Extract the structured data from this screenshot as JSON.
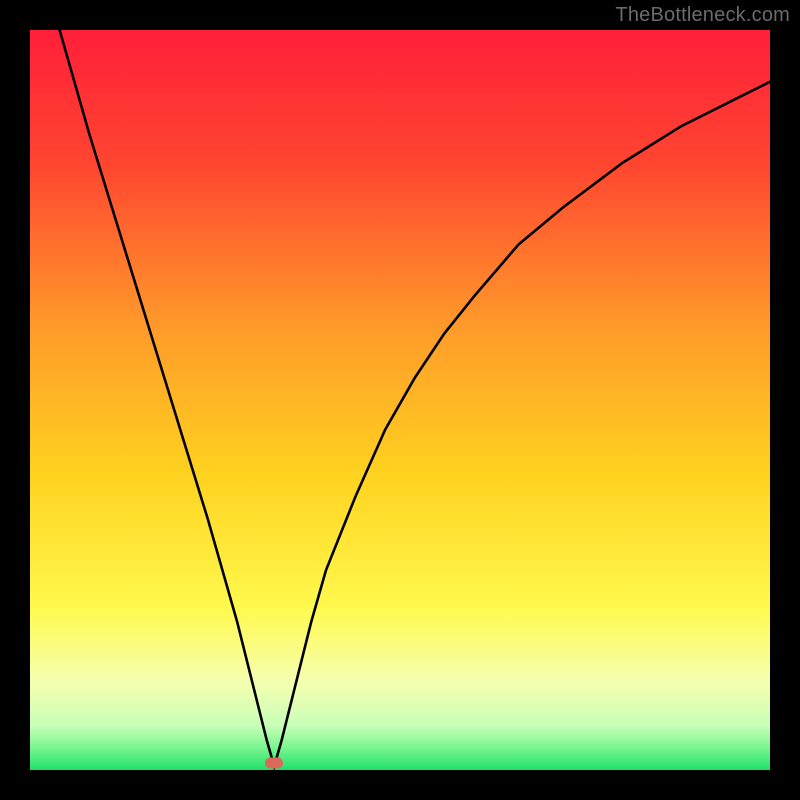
{
  "watermark": "TheBottleneck.com",
  "colors": {
    "gradient_top": "#ff1f3a",
    "gradient_mid1": "#ff7a2a",
    "gradient_mid2": "#ffd21f",
    "gradient_mid3": "#fff94d",
    "gradient_bottom": "#1fe06a",
    "curve": "#000000",
    "marker": "#d96a5a",
    "frame": "#000000"
  },
  "chart_data": {
    "type": "line",
    "title": "",
    "xlabel": "",
    "ylabel": "",
    "xlim": [
      0,
      100
    ],
    "ylim": [
      0,
      100
    ],
    "annotations": [
      {
        "type": "marker",
        "x": 33,
        "y": 1
      }
    ],
    "series": [
      {
        "name": "bottleneck-curve",
        "x": [
          4,
          8,
          12,
          16,
          20,
          24,
          28,
          30,
          32,
          33,
          34,
          36,
          38,
          40,
          44,
          48,
          52,
          56,
          60,
          66,
          72,
          80,
          88,
          96,
          100
        ],
        "values": [
          100,
          86,
          73,
          60,
          47,
          34,
          20,
          12,
          4,
          0.5,
          4,
          12,
          20,
          27,
          37,
          46,
          53,
          59,
          64,
          71,
          76,
          82,
          87,
          91,
          93
        ]
      }
    ]
  }
}
